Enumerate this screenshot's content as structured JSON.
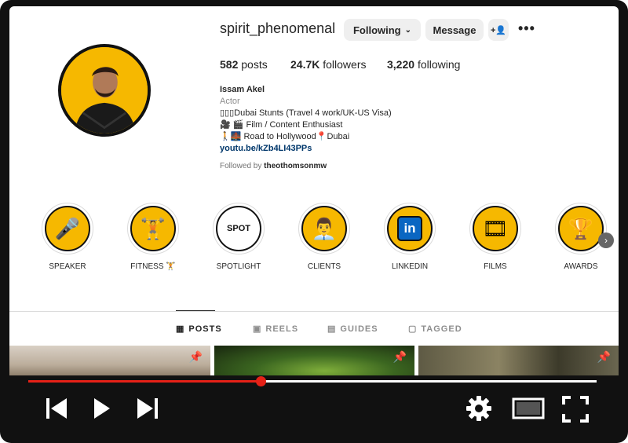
{
  "profile": {
    "username": "spirit_phenomenal",
    "following_label": "Following",
    "message_label": "Message",
    "posts_count": "582",
    "posts_label": "posts",
    "followers_count": "24.7K",
    "followers_label": "followers",
    "following_count": "3,220",
    "following_word": "following",
    "name": "Issam Akel",
    "category": "Actor",
    "bio_line1": "▯▯▯Dubai Stunts (Travel 4 work/UK-US Visa)",
    "bio_line2": "🎥 🎬 Film / Content Enthusiast",
    "bio_line3": "🚶🌉 Road to Hollywood📍Dubai",
    "link": "youtu.be/kZb4LI43PPs",
    "followed_by_prefix": "Followed by",
    "followed_by_user": "theothomsonmw"
  },
  "highlights": [
    {
      "label": "SPEAKER",
      "icon": "🎤"
    },
    {
      "label": "FITNESS 🏋",
      "icon": "🏋"
    },
    {
      "label": "SPOTLIGHT",
      "icon": "SPOT"
    },
    {
      "label": "CLIENTS",
      "icon": "👨‍💼"
    },
    {
      "label": "LINKEDIN",
      "icon": "in"
    },
    {
      "label": "FILMS",
      "icon": "🎞"
    },
    {
      "label": "AWARDS",
      "icon": "🏆"
    }
  ],
  "tabs": [
    {
      "label": "POSTS",
      "icon": "grid-icon"
    },
    {
      "label": "REELS",
      "icon": "reels-icon"
    },
    {
      "label": "GUIDES",
      "icon": "guides-icon"
    },
    {
      "label": "TAGGED",
      "icon": "tagged-icon"
    }
  ],
  "player": {
    "progress": 0.41,
    "accent": "#e62117"
  },
  "colors": {
    "brand_yellow": "#f6b800",
    "link": "#00376b"
  }
}
